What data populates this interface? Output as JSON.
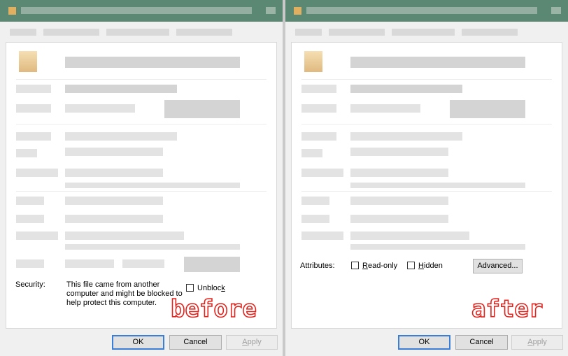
{
  "left": {
    "security_label": "Security:",
    "security_message": "This file came from another computer and might be blocked to help protect this computer.",
    "unblock_prefix": "Unbloc",
    "unblock_accel": "k",
    "overlay": "before"
  },
  "right": {
    "attributes_label": "Attributes:",
    "readonly_accel": "R",
    "readonly_rest": "ead-only",
    "hidden_accel": "H",
    "hidden_rest": "idden",
    "advanced_label": "Advanced...",
    "overlay": "after"
  },
  "buttons": {
    "ok": "OK",
    "cancel": "Cancel",
    "apply_accel": "A",
    "apply_rest": "pply"
  },
  "colors": {
    "titlebar": "#5b8872",
    "overlay_stroke": "#e0241e",
    "default_button_border": "#3a7fd5"
  }
}
